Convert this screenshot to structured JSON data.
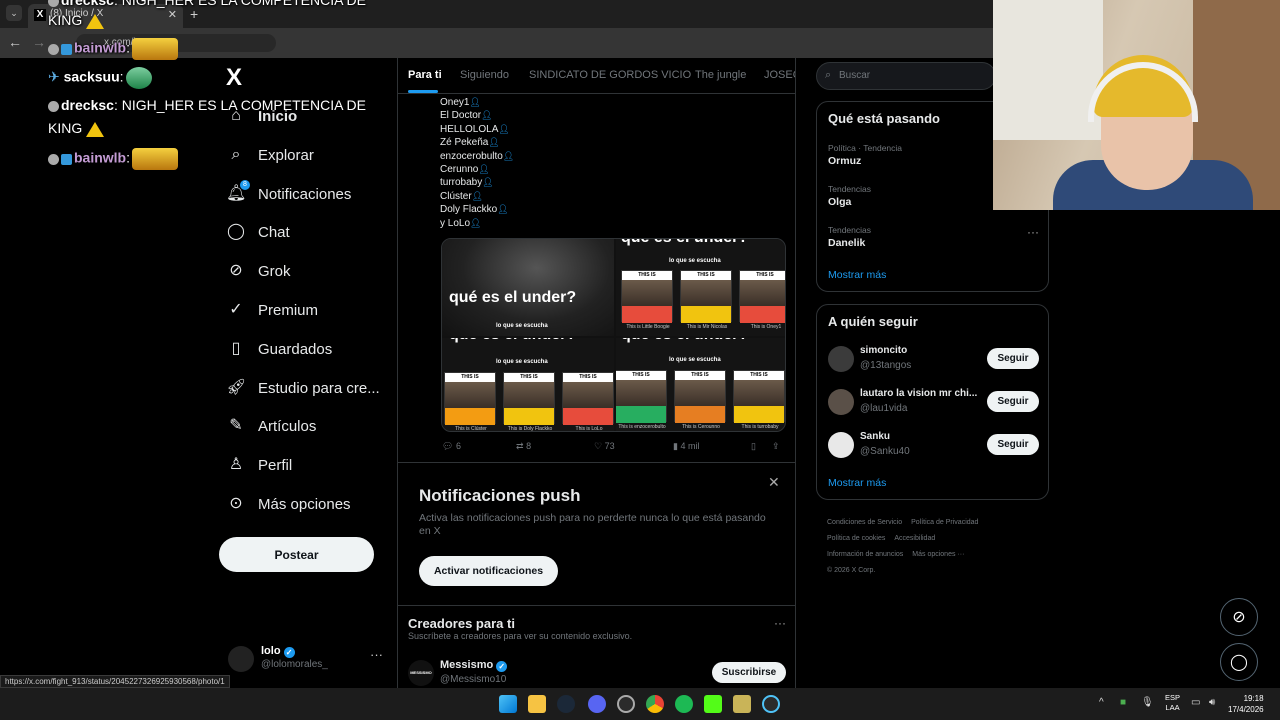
{
  "browser": {
    "tab_title": "(8) Inicio / X",
    "url": "x.com/home"
  },
  "chat": [
    {
      "user": "drecksc",
      "message": ": NIGH_HER ES LA COMPETENCIA DE"
    },
    {
      "user": "",
      "message": "KING"
    },
    {
      "user": "bainwlb",
      "message": ":"
    },
    {
      "user": "sacksuu",
      "message": ":"
    },
    {
      "user": "drecksc",
      "message": ": NIGH_HER ES LA COMPETENCIA DE"
    },
    {
      "user": "",
      "message": "KING"
    },
    {
      "user": "bainwlb",
      "message": ":"
    }
  ],
  "nav": {
    "logo": "X",
    "items": [
      {
        "label": "Inicio",
        "icon": "home-icon"
      },
      {
        "label": "Explorar",
        "icon": "search-icon"
      },
      {
        "label": "Notificaciones",
        "icon": "bell-icon",
        "badge": "8"
      },
      {
        "label": "Chat",
        "icon": "chat-icon"
      },
      {
        "label": "Grok",
        "icon": "grok-icon"
      },
      {
        "label": "Premium",
        "icon": "premium-icon"
      },
      {
        "label": "Guardados",
        "icon": "bookmark-icon"
      },
      {
        "label": "Estudio para cre...",
        "icon": "rocket-icon"
      },
      {
        "label": "Artículos",
        "icon": "article-icon"
      },
      {
        "label": "Perfil",
        "icon": "person-icon"
      },
      {
        "label": "Más opciones",
        "icon": "more-icon"
      }
    ],
    "post_label": "Postear"
  },
  "profile": {
    "name": "lolo",
    "handle": "@lolomorales_",
    "more": "···"
  },
  "feed_tabs": [
    "Para ti",
    "Siguiendo",
    "SINDICATO DE GORDOS VICIO",
    "The jungle",
    "JOSEO"
  ],
  "tweet": {
    "mentions": [
      "Oney1",
      "El Doctor",
      "HELLOLOLA",
      "Zé Pekeña",
      "enzocerobulto",
      "Cerunno",
      "turrobaby",
      "Clúster",
      "Doly Flackko",
      "y LoLo"
    ],
    "media": {
      "headline": "qué es el under?",
      "subhead": "lo que se escucha",
      "this_is": "THIS IS",
      "covers_top": [
        {
          "caption": "This is Little Boogie",
          "name": "Little Boogie",
          "color": "#e74c3c"
        },
        {
          "caption": "This is Mir Nicolas",
          "name": "Mir Nicolas",
          "color": "#f1c40f"
        },
        {
          "caption": "This is Oney1",
          "name": "Oney1",
          "color": "#e74c3c"
        }
      ],
      "covers_bottom": [
        {
          "caption": "This is Clúster",
          "name": "Clúster",
          "color": "#f39c12"
        },
        {
          "caption": "This is Doly Flackko",
          "name": "Doly Flackko",
          "color": "#f1c40f"
        },
        {
          "caption": "This is LoLo",
          "name": "LoLo",
          "color": "#e74c3c"
        },
        {
          "caption": "This is enzocerobulto",
          "name": "enzocerobulto",
          "color": "#27ae60"
        },
        {
          "caption": "This is Cerounno",
          "name": "Cerounno",
          "color": "#e67e22"
        },
        {
          "caption": "This is turrobaby",
          "name": "turrobaby",
          "color": "#f1c40f"
        }
      ]
    },
    "stats": {
      "replies": "6",
      "reposts": "8",
      "likes": "73",
      "views": "4 mil"
    }
  },
  "push": {
    "title": "Notificaciones push",
    "description": "Activa las notificaciones push para no perderte nunca lo que está pasando en X",
    "button": "Activar notificaciones",
    "close": "✕"
  },
  "creators": {
    "title": "Creadores para ti",
    "subtitle": "Suscríbete a creadores para ver su contenido exclusivo.",
    "name": "Messismo",
    "handle": "@Messismo10",
    "avatar_text": "MESSISMO",
    "button": "Suscribirse"
  },
  "search": {
    "placeholder": "Buscar"
  },
  "trends": {
    "title": "Qué está pasando",
    "items": [
      {
        "meta": "Política · Tendencia",
        "name": "Ormuz"
      },
      {
        "meta": "Tendencias",
        "name": "Olga"
      },
      {
        "meta": "Tendencias",
        "name": "Danelik"
      }
    ],
    "show_more": "Mostrar más"
  },
  "who_to_follow": {
    "title": "A quién seguir",
    "items": [
      {
        "name": "simoncito",
        "handle": "@13tangos",
        "button": "Seguir"
      },
      {
        "name": "lautaro la vision mr chi...",
        "handle": "@lau1vida",
        "button": "Seguir"
      },
      {
        "name": "Sanku",
        "handle": "@Sanku40",
        "button": "Seguir"
      }
    ],
    "show_more": "Mostrar más"
  },
  "footer": {
    "links": [
      "Condiciones de Servicio",
      "Política de Privacidad",
      "Política de cookies",
      "Accesibilidad",
      "Información de anuncios",
      "Más opciones ···"
    ],
    "copyright": "© 2026 X Corp."
  },
  "status_link": "https://x.com/fight_913/status/2045227326925930568/photo/1",
  "taskbar": {
    "lang_top": "ESP",
    "lang_bottom": "LAA",
    "time": "19:18",
    "date": "17/4/2026"
  },
  "colors": {
    "accent": "#1d9bf0",
    "background": "#000000",
    "border": "#2f3336",
    "muted": "#71767b"
  }
}
